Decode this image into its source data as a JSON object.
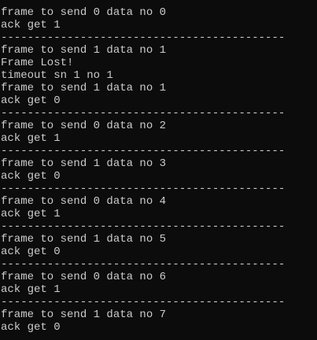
{
  "console": {
    "lines": [
      "-------------------------------------------",
      "frame to send 0 data no 0",
      "ack get 1",
      "-------------------------------------------",
      "frame to send 1 data no 1",
      "Frame Lost!",
      "timeout sn 1 no 1",
      "frame to send 1 data no 1",
      "ack get 0",
      "-------------------------------------------",
      "frame to send 0 data no 2",
      "ack get 1",
      "-------------------------------------------",
      "frame to send 1 data no 3",
      "ack get 0",
      "-------------------------------------------",
      "frame to send 0 data no 4",
      "ack get 1",
      "-------------------------------------------",
      "frame to send 1 data no 5",
      "ack get 0",
      "-------------------------------------------",
      "frame to send 0 data no 6",
      "ack get 1",
      "-------------------------------------------",
      "frame to send 1 data no 7",
      "ack get 0"
    ]
  },
  "colors": {
    "background": "#0c0c0c",
    "text": "#cccccc"
  }
}
